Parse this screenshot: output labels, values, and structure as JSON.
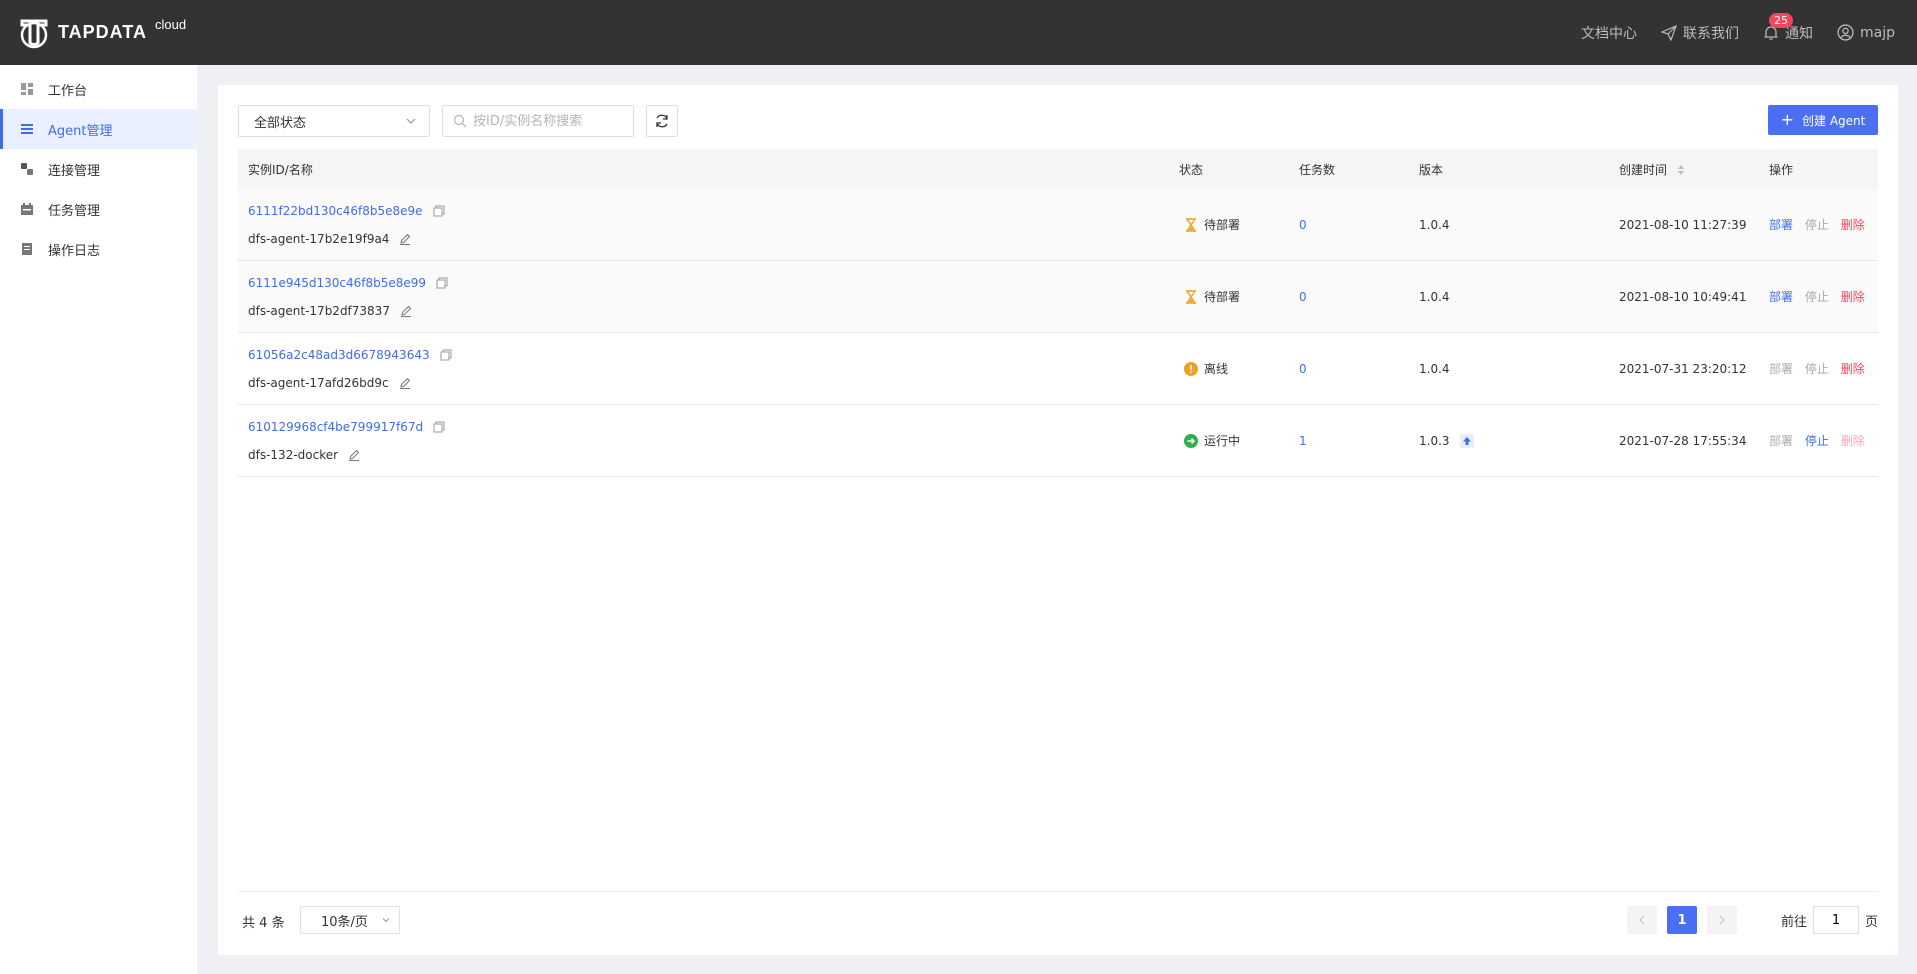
{
  "header": {
    "logo_text": "TAPDATA",
    "logo_sup": "cloud",
    "docs": "文档中心",
    "contact": "联系我们",
    "notify_badge": "25",
    "notify": "通知",
    "user": "majp"
  },
  "sidebar": {
    "items": [
      {
        "label": "工作台",
        "icon": "dashboard-icon"
      },
      {
        "label": "Agent管理",
        "icon": "list-icon",
        "active": true
      },
      {
        "label": "连接管理",
        "icon": "link-icon"
      },
      {
        "label": "任务管理",
        "icon": "calendar-icon"
      },
      {
        "label": "操作日志",
        "icon": "document-icon"
      }
    ]
  },
  "toolbar": {
    "status_select": "全部状态",
    "search_placeholder": "按ID/实例名称搜索",
    "create_label": "创建 Agent"
  },
  "table": {
    "headers": {
      "id": "实例ID/名称",
      "status": "状态",
      "tasks": "任务数",
      "version": "版本",
      "created": "创建时间",
      "ops": "操作"
    },
    "rows": [
      {
        "id": "6111f22bd130c46f8b5e8e9e",
        "name": "dfs-agent-17b2e19f9a4",
        "status": "待部署",
        "status_icon": "hourglass-icon",
        "tasks": "0",
        "version": "1.0.4",
        "upgrade": false,
        "created": "2021-08-10 11:27:39",
        "op_deploy": "部署",
        "op_stop": "停止",
        "op_delete": "删除"
      },
      {
        "id": "6111e945d130c46f8b5e8e99",
        "name": "dfs-agent-17b2df73837",
        "status": "待部署",
        "status_icon": "hourglass-icon",
        "tasks": "0",
        "version": "1.0.4",
        "upgrade": false,
        "created": "2021-08-10 10:49:41",
        "op_deploy": "部署",
        "op_stop": "停止",
        "op_delete": "删除"
      },
      {
        "id": "61056a2c48ad3d6678943643",
        "name": "dfs-agent-17afd26bd9c",
        "status": "离线",
        "status_icon": "warning-icon",
        "tasks": "0",
        "version": "1.0.4",
        "upgrade": false,
        "created": "2021-07-31 23:20:12",
        "op_deploy": "部署",
        "op_stop": "停止",
        "op_delete": "删除"
      },
      {
        "id": "610129968cf4be799917f67d",
        "name": "dfs-132-docker",
        "status": "运行中",
        "status_icon": "running-icon",
        "tasks": "1",
        "version": "1.0.3",
        "upgrade": true,
        "created": "2021-07-28 17:55:34",
        "op_deploy": "部署",
        "op_stop": "停止",
        "op_delete": "删除"
      }
    ]
  },
  "pagination": {
    "total_prefix": "共",
    "total": "4",
    "total_suffix": "条",
    "page_size": "10条/页",
    "current_page": "1",
    "goto_label": "前往",
    "goto_value": "1",
    "page_unit": "页"
  },
  "colors": {
    "primary": "#4a6ff2",
    "header_bg": "#333333",
    "danger": "#f5455f",
    "pending": "#f0a020",
    "offline": "#f0a020",
    "running": "#2bb24c"
  }
}
